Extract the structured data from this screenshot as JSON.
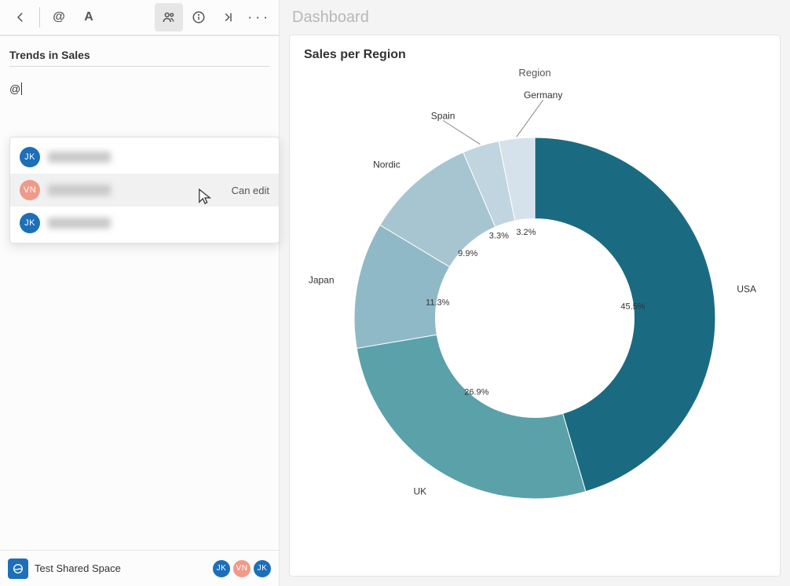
{
  "toolbar": {
    "mention_glyph": "@",
    "text_tool_glyph": "A",
    "more_glyph": "· · ·"
  },
  "side": {
    "section_title": "Trends in Sales",
    "input_value": "@",
    "dropdown": [
      {
        "initials": "JK",
        "color": "blue",
        "name": "████████",
        "right": ""
      },
      {
        "initials": "VN",
        "color": "salmon",
        "name": "██████",
        "right": "Can edit",
        "hover": true
      },
      {
        "initials": "JK",
        "color": "blue",
        "name": "███████",
        "right": ""
      }
    ]
  },
  "footer": {
    "space_name": "Test Shared Space",
    "avatars": [
      {
        "initials": "JK",
        "color": "blue"
      },
      {
        "initials": "VN",
        "color": "salmon"
      },
      {
        "initials": "JK",
        "color": "blue"
      }
    ]
  },
  "main": {
    "header_title": "Dashboard",
    "card_title": "Sales per Region",
    "legend_title": "Region"
  },
  "chart_data": {
    "type": "pie",
    "title": "Sales per Region",
    "legend_title": "Region",
    "inner_radius_ratio": 0.55,
    "start_angle_deg_from_top": 0,
    "slices": [
      {
        "label": "USA",
        "value": 45.5,
        "color": "#1a6b82"
      },
      {
        "label": "UK",
        "value": 26.9,
        "color": "#5aa1aa"
      },
      {
        "label": "Japan",
        "value": 11.3,
        "color": "#8fb9c6"
      },
      {
        "label": "Nordic",
        "value": 9.9,
        "color": "#a7c5d1"
      },
      {
        "label": "Spain",
        "value": 3.3,
        "color": "#c0d5e0"
      },
      {
        "label": "Germany",
        "value": 3.2,
        "color": "#d6e2eb"
      }
    ],
    "value_suffix": "%"
  }
}
